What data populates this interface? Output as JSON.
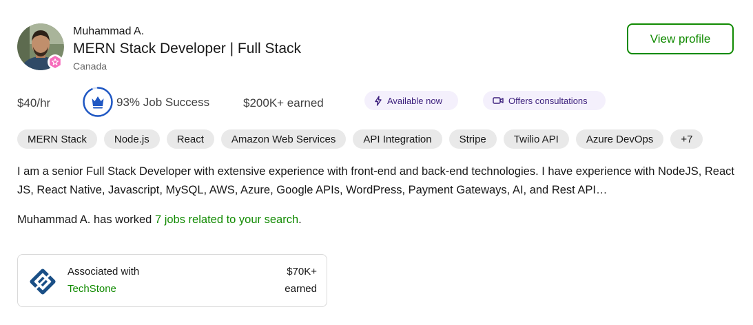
{
  "profile": {
    "name": "Muhammad A.",
    "title": "MERN Stack Developer | Full Stack",
    "location": "Canada",
    "view_profile_label": "View profile",
    "avatar_icon": "user-photo",
    "badge_icon": "rising-talent-badge-icon"
  },
  "stats": {
    "rate": "$40/hr",
    "job_success": "93% Job Success",
    "job_success_value": 0.93,
    "earned": "$200K+ earned",
    "available_label": "Available now",
    "consultations_label": "Offers consultations"
  },
  "skills": [
    "MERN Stack",
    "Node.js",
    "React",
    "Amazon Web Services",
    "API Integration",
    "Stripe",
    "Twilio API",
    "Azure DevOps",
    "+7"
  ],
  "description": "I am a senior Full Stack Developer with extensive experience with front-end and back-end technologies. I have experience with NodeJS, React JS, React Native, Javascript, MySQL, AWS, Azure, Google APIs, WordPress, Payment Gateways, AI, and Rest API…",
  "worked": {
    "prefix": "Muhammad A. has worked ",
    "link": "7 jobs related to your search",
    "suffix": "."
  },
  "association": {
    "label": "Associated with",
    "company": "TechStone",
    "amount": "$70K+",
    "earned_label": "earned"
  },
  "colors": {
    "accent_green": "#108a00",
    "job_success_blue": "#1f57c3",
    "pill_bg": "#f4f0fc",
    "pill_text": "#3c1f7d",
    "badge_pink": "#f66dbc"
  }
}
